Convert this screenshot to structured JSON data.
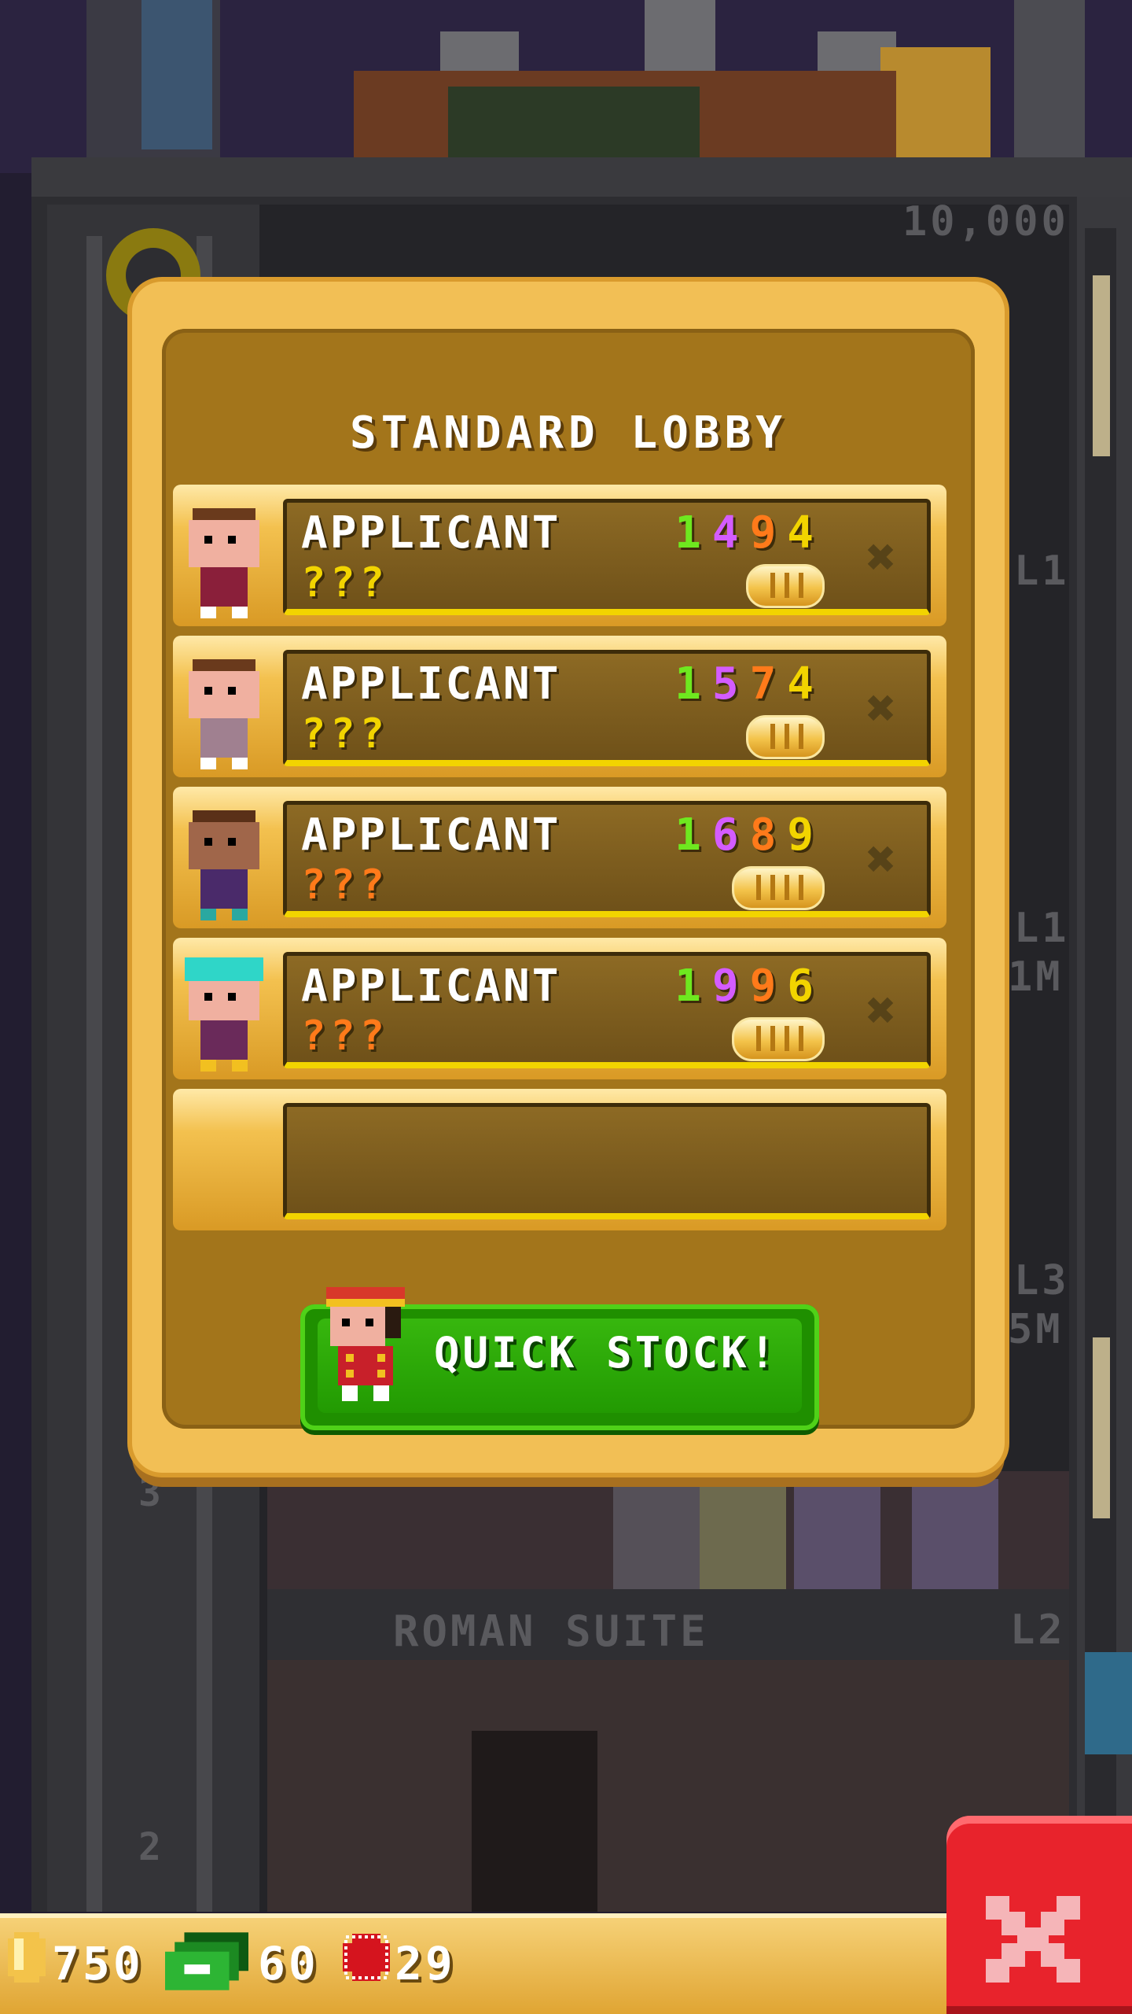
{
  "background": {
    "tower_top_value": "10,000",
    "floor_levels": [
      "L1",
      "L1",
      "L3",
      "L2"
    ],
    "side_values": [
      "1M",
      "5M"
    ],
    "floor_numbers": [
      "3",
      "2"
    ],
    "suite_name": "ROMAN SUITE"
  },
  "modal": {
    "title": "STANDARD LOBBY",
    "applicants": [
      {
        "name": "APPLICANT",
        "unknown": "???",
        "unknown_color": "#f2d400",
        "stats": [
          "1",
          "4",
          "9",
          "4"
        ],
        "coin_level": 3,
        "remove_icon": "x-icon"
      },
      {
        "name": "APPLICANT",
        "unknown": "???",
        "unknown_color": "#f2d400",
        "stats": [
          "1",
          "5",
          "7",
          "4"
        ],
        "coin_level": 3,
        "remove_icon": "x-icon"
      },
      {
        "name": "APPLICANT",
        "unknown": "???",
        "unknown_color": "#ff7a1a",
        "stats": [
          "1",
          "6",
          "8",
          "9"
        ],
        "coin_level": 4,
        "remove_icon": "x-icon"
      },
      {
        "name": "APPLICANT",
        "unknown": "???",
        "unknown_color": "#ff7a1a",
        "stats": [
          "1",
          "9",
          "9",
          "6"
        ],
        "coin_level": 4,
        "remove_icon": "x-icon"
      }
    ],
    "stat_colors": [
      "#6ee81f",
      "#d45cff",
      "#ff7a1a",
      "#f2d400"
    ],
    "quick_stock_label": "QUICK STOCK!"
  },
  "currency": {
    "coins": "750",
    "bux": "60",
    "tickets": "29"
  },
  "close_icon": "close-icon"
}
